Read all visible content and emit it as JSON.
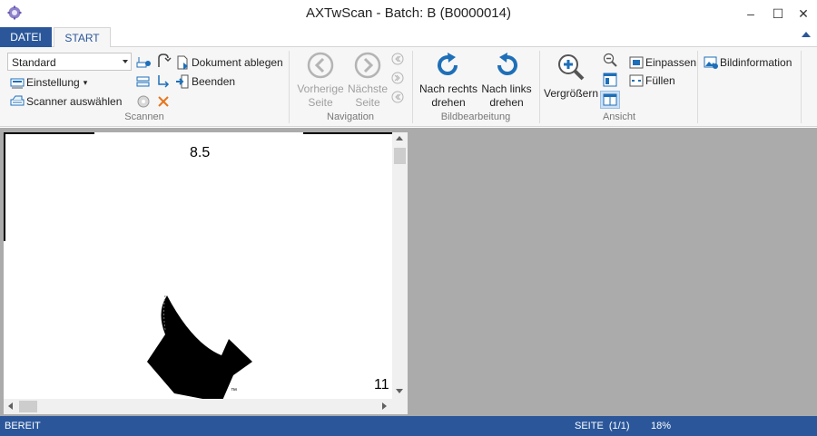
{
  "window": {
    "title": "AXTwScan - Batch: B (B0000014)",
    "minimize": "–",
    "maximize": "☐",
    "close": "✕"
  },
  "tabs": {
    "file": "DATEI",
    "start": "START"
  },
  "ribbon": {
    "scan": {
      "profile_value": "Standard",
      "settings_label": "Einstellung",
      "settings_arrow": "▾",
      "select_scanner_label": "Scanner auswählen",
      "file_document_label": "Dokument ablegen",
      "exit_label": "Beenden",
      "group_label": "Scannen"
    },
    "navigation": {
      "prev_label_1": "Vorherige",
      "prev_label_2": "Seite",
      "next_label_1": "Nächste",
      "next_label_2": "Seite",
      "group_label": "Navigation"
    },
    "image_edit": {
      "rotate_right_1": "Nach rechts",
      "rotate_right_2": "drehen",
      "rotate_left_1": "Nach links",
      "rotate_left_2": "drehen",
      "group_label": "Bildbearbeitung"
    },
    "view": {
      "zoom_in_label": "Vergrößern",
      "fit_label": "Einpassen",
      "fill_label": "Füllen",
      "group_label": "Ansicht"
    },
    "info": {
      "image_info_label": "Bildinformation"
    }
  },
  "document": {
    "page_number_top": "8.5",
    "page_number_bottom": "11",
    "trademark": "™"
  },
  "status": {
    "state": "BEREIT",
    "page": "SEITE  (1/1)",
    "zoom": "18%"
  },
  "colors": {
    "accent": "#2b579a",
    "ribbon_bg": "#f6f6f6",
    "viewer_bg": "#ababab",
    "icon_blue": "#1e6fb8",
    "disabled_gray": "#b4b4b4"
  }
}
